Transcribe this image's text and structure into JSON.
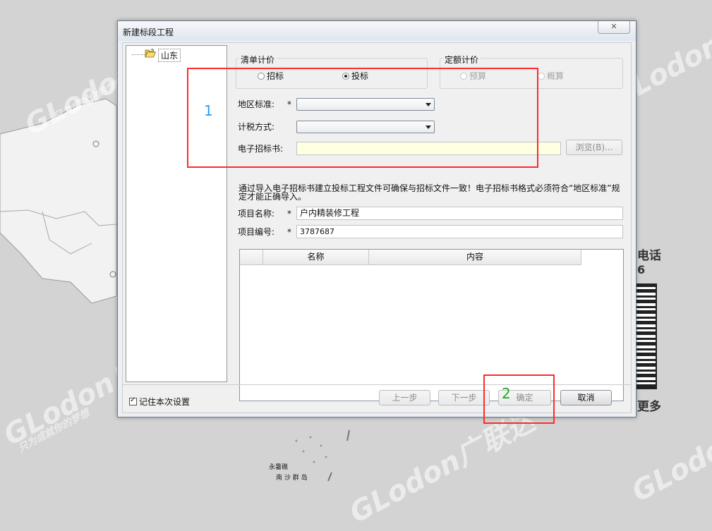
{
  "dialog": {
    "title": "新建标段工程",
    "close_icon": "close-icon"
  },
  "tree": {
    "root_label": "山东",
    "root_icon": "folder-open-icon"
  },
  "qingdan": {
    "legend": "清单计价",
    "options": [
      {
        "label": "招标",
        "selected": false
      },
      {
        "label": "投标",
        "selected": true
      }
    ]
  },
  "dinge": {
    "legend": "定额计价",
    "options": [
      {
        "label": "预算",
        "selected": false,
        "disabled": true
      },
      {
        "label": "概算",
        "selected": false,
        "disabled": true
      }
    ]
  },
  "form": {
    "region_label": "地区标准:",
    "tax_label": "计税方式:",
    "ebook_label": "电子招标书:",
    "browse_label": "浏览(B)...",
    "required_mark": "*",
    "note": "通过导入电子招标书建立投标工程文件可确保与招标文件一致！电子招标书格式必须符合“地区标准”规定才能正确导入。",
    "project_name_label": "项目名称:",
    "project_name_value": "户内精装修工程",
    "project_no_label": "项目编号:",
    "project_no_value": "3787687"
  },
  "grid": {
    "columns": [
      "名称",
      "内容"
    ]
  },
  "footer": {
    "remember_label": "记住本次设置",
    "remember_checked": true,
    "prev_label": "上一步",
    "next_label": "下一步",
    "ok_label": "确定",
    "cancel_label": "取消"
  },
  "annotations": {
    "one": "1",
    "two": "2",
    "one_color": "#2a9df4",
    "two_color": "#22aa22",
    "box_color": "#ff2b2b"
  },
  "background": {
    "watermark_brand": "GLodon广联达",
    "watermark_slogan": "只为成就你的梦想",
    "side_text_1": "电话",
    "side_text_2": "6",
    "side_text_3": "更多",
    "map_label_1": "永暑礁",
    "map_label_2": "南 沙 群 岛"
  }
}
